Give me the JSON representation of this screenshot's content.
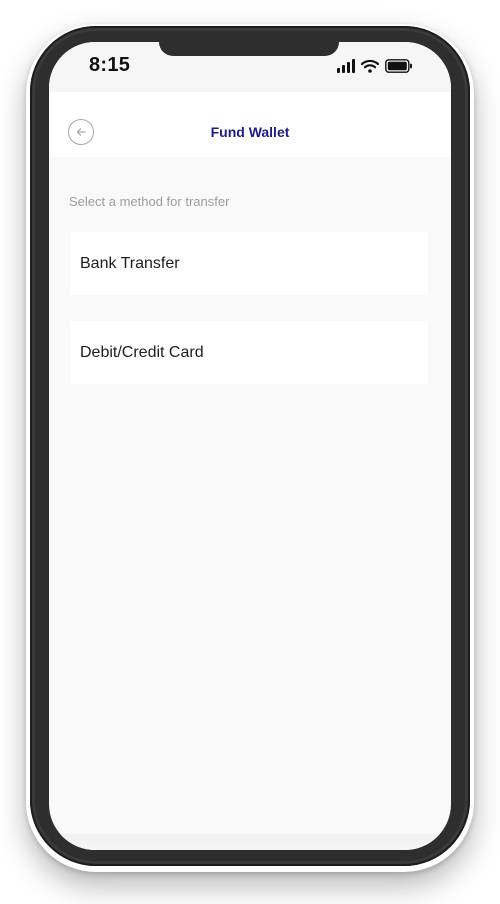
{
  "status_bar": {
    "time": "8:15",
    "icons": [
      "cellular-signal-icon",
      "wifi-icon",
      "battery-icon"
    ]
  },
  "header": {
    "back_icon": "arrow-left-circle-icon",
    "title": "Fund Wallet"
  },
  "main": {
    "section_label": "Select a method for transfer",
    "methods": [
      {
        "label": "Bank Transfer"
      },
      {
        "label": "Debit/Credit Card"
      }
    ]
  },
  "colors": {
    "title": "#1f1c8a",
    "screen_background": "#f9f9f9",
    "card_background": "#ffffff",
    "label_text": "#9d9d9d"
  }
}
